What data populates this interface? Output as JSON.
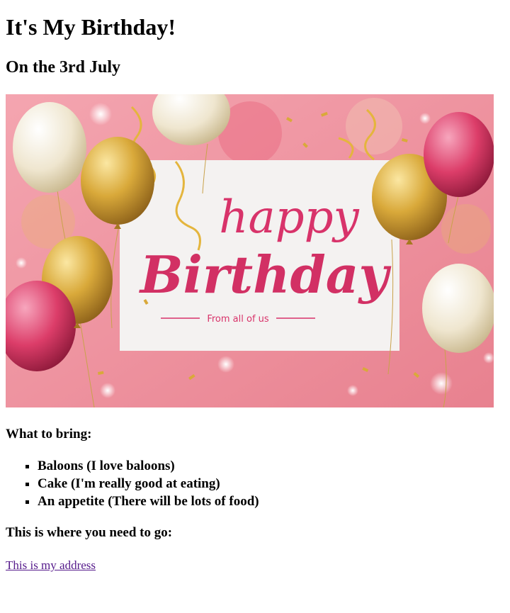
{
  "page": {
    "title": "It's My Birthday!",
    "subtitle": "On the 3rd July"
  },
  "banner": {
    "script_top": "happy",
    "script_main": "Birthday",
    "from_line": "From all of us",
    "background": "#ef8f9c",
    "accent": "#e0356d"
  },
  "bring": {
    "heading": "What to bring:",
    "items": [
      "Baloons (I love baloons)",
      "Cake (I'm really good at eating)",
      "An appetite (There will be lots of food)"
    ]
  },
  "location": {
    "heading": "This is where you need to go:",
    "link_text": "This is my address"
  }
}
